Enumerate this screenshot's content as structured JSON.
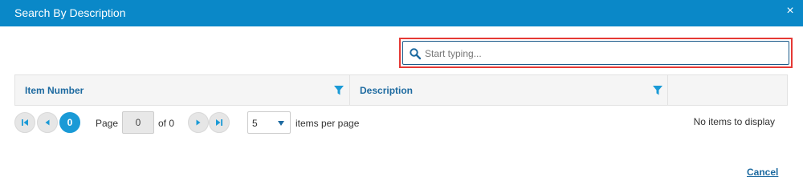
{
  "dialog": {
    "title": "Search By Description",
    "close_label": "×"
  },
  "search": {
    "placeholder": "Start typing...",
    "value": ""
  },
  "grid": {
    "columns": [
      {
        "label": "Item Number"
      },
      {
        "label": "Description"
      },
      {
        "label": ""
      }
    ]
  },
  "pager": {
    "current_page": "0",
    "page_label": "Page",
    "page_input_value": "0",
    "of_label": "of 0",
    "page_size": "5",
    "items_per_page_label": "items per page",
    "status": "No items to display"
  },
  "footer": {
    "cancel_label": "Cancel"
  },
  "colors": {
    "header_bg": "#0a88c8",
    "accent": "#1a9ad6",
    "link": "#1d6aa0",
    "highlight_border": "#e53935"
  }
}
